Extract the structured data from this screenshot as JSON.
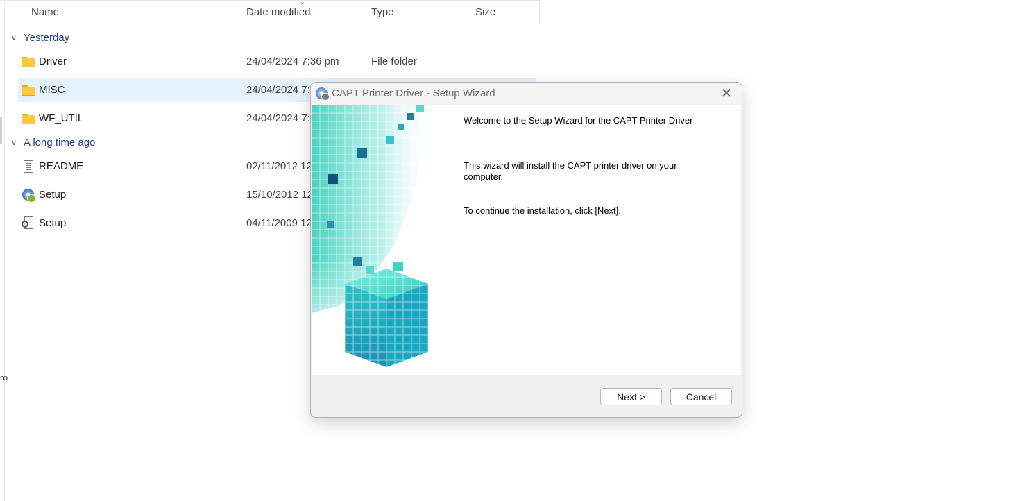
{
  "explorer": {
    "columns": {
      "name": "Name",
      "date_modified": "Date modified",
      "type": "Type",
      "size": "Size"
    },
    "sort_indicator": "chevron-down",
    "groups": [
      {
        "label": "Yesterday",
        "items": [
          {
            "name": "Driver",
            "date": "24/04/2024 7:36 pm",
            "type": "File folder",
            "icon": "folder-icon"
          },
          {
            "name": "MISC",
            "date": "24/04/2024 7:",
            "type": "",
            "icon": "folder-icon",
            "selected": true
          },
          {
            "name": "WF_UTIL",
            "date": "24/04/2024 7:",
            "type": "",
            "icon": "folder-icon"
          }
        ]
      },
      {
        "label": "A long time ago",
        "items": [
          {
            "name": "README",
            "date": "02/11/2012 12",
            "type": "",
            "icon": "text-document-icon"
          },
          {
            "name": "Setup",
            "date": "15/10/2012 12",
            "type": "",
            "icon": "setup-installer-icon"
          },
          {
            "name": "Setup",
            "date": "04/11/2009 12",
            "type": "",
            "icon": "config-file-icon"
          }
        ]
      }
    ],
    "selection_color": "#e5f1fb",
    "group_label_color": "#1f3b8a"
  },
  "dialog": {
    "title": "CAPT Printer Driver - Setup Wizard",
    "close_glyph": "✕",
    "paragraphs": [
      "Welcome to the Setup Wizard for the CAPT Printer Driver",
      "This wizard will install the CAPT printer driver on your computer.",
      "To continue the installation, click [Next]."
    ],
    "buttons": {
      "next": "Next >",
      "cancel": "Cancel"
    },
    "banner_accent": "#2fd3c4"
  }
}
